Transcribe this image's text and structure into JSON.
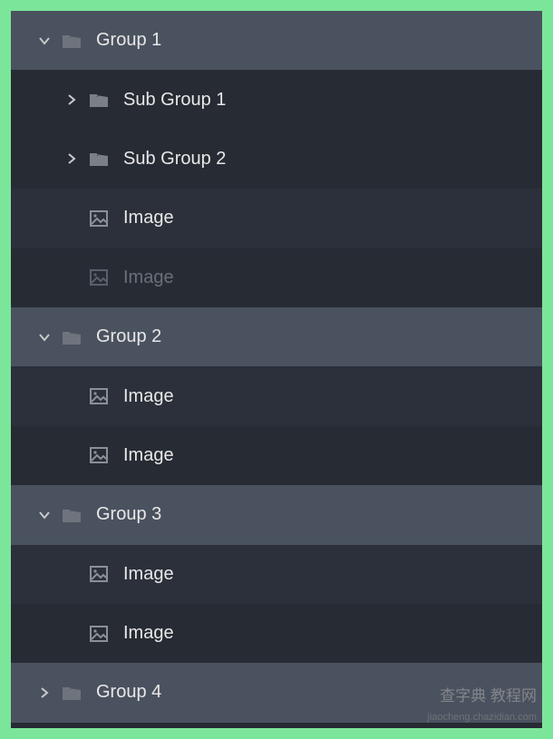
{
  "tree": {
    "nodes": [
      {
        "type": "group",
        "label": "Group 1",
        "indent": 0,
        "expanded": true,
        "rowClass": "header"
      },
      {
        "type": "group",
        "label": "Sub Group 1",
        "indent": 1,
        "expanded": false,
        "rowClass": "item-dark"
      },
      {
        "type": "group",
        "label": "Sub Group 2",
        "indent": 1,
        "expanded": false,
        "rowClass": "item-dark"
      },
      {
        "type": "image",
        "label": "Image",
        "indent": 1,
        "rowClass": "item"
      },
      {
        "type": "image",
        "label": "Image",
        "indent": 1,
        "rowClass": "item-dark",
        "dimmed": true
      },
      {
        "type": "group",
        "label": "Group 2",
        "indent": 0,
        "expanded": true,
        "rowClass": "header"
      },
      {
        "type": "image",
        "label": "Image",
        "indent": 1,
        "rowClass": "item"
      },
      {
        "type": "image",
        "label": "Image",
        "indent": 1,
        "rowClass": "item-dark"
      },
      {
        "type": "group",
        "label": "Group 3",
        "indent": 0,
        "expanded": true,
        "rowClass": "header"
      },
      {
        "type": "image",
        "label": "Image",
        "indent": 1,
        "rowClass": "item"
      },
      {
        "type": "image",
        "label": "Image",
        "indent": 1,
        "rowClass": "item-dark"
      },
      {
        "type": "group",
        "label": "Group 4",
        "indent": 0,
        "expanded": false,
        "rowClass": "header"
      }
    ]
  },
  "watermark": {
    "line1": "查字典 教程网",
    "line2": "jiaocheng.chazidian.com"
  },
  "colors": {
    "pageBg": "#7be59a",
    "panelBg": "#272b34",
    "headerBg": "#4a525f",
    "itemBg": "#2b303a",
    "text": "#e8e8e8",
    "textDim": "#6b6f78"
  }
}
